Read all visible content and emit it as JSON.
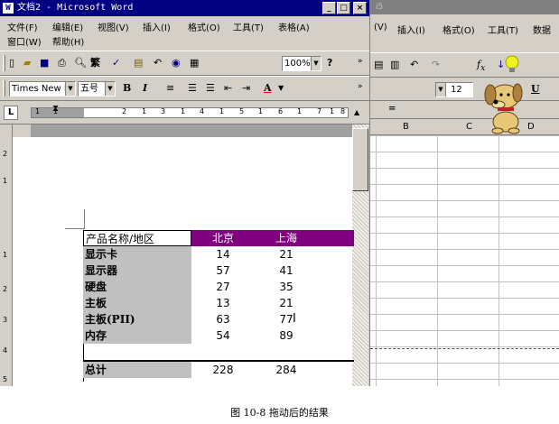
{
  "word": {
    "title": "文档2 - Microsoft Word",
    "title_icon": "W",
    "menus": [
      "文件(F)",
      "编辑(E)",
      "视图(V)",
      "插入(I)",
      "格式(O)",
      "工具(T)",
      "表格(A)",
      "窗口(W)",
      "帮助(H)"
    ],
    "standard_toolbar": {
      "zoom": "100%",
      "traditional": "繁"
    },
    "format_toolbar": {
      "font": "Times New Ro",
      "size": "五号",
      "bold": "B",
      "italic": "I",
      "font_color": "A"
    },
    "ruler_numbers": [
      "1",
      "1",
      "2",
      "1",
      "3",
      "1",
      "4",
      "1",
      "5",
      "1",
      "6",
      "1",
      "7",
      "1",
      "8"
    ],
    "vruler_numbers": [
      "2",
      "1",
      "1",
      "2",
      "3",
      "4",
      "5"
    ],
    "table": {
      "header": [
        "产品名称/地区",
        "北京",
        "上海",
        ""
      ],
      "rows": [
        [
          "显示卡",
          "14",
          "21"
        ],
        [
          "显示器",
          "57",
          "41"
        ],
        [
          "硬盘",
          "27",
          "35"
        ],
        [
          "主板",
          "13",
          "21"
        ],
        [
          "主板(PII)",
          "63",
          "77"
        ],
        [
          "内存",
          "54",
          "89"
        ],
        [
          "总计",
          "228",
          "284"
        ]
      ]
    }
  },
  "excel": {
    "title": "i5",
    "menus": [
      "(V)",
      "插入(I)",
      "格式(O)",
      "工具(T)",
      "数据"
    ],
    "font_size": "12",
    "name_box": "=",
    "columns": [
      "B",
      "C",
      "D"
    ]
  },
  "caption": "图 10-8  拖动后的结果",
  "colors": {
    "title_bar": "#000080",
    "header_fill": "#800080",
    "first_col_fill": "#c0c0c0",
    "chrome": "#d4d0c8"
  }
}
